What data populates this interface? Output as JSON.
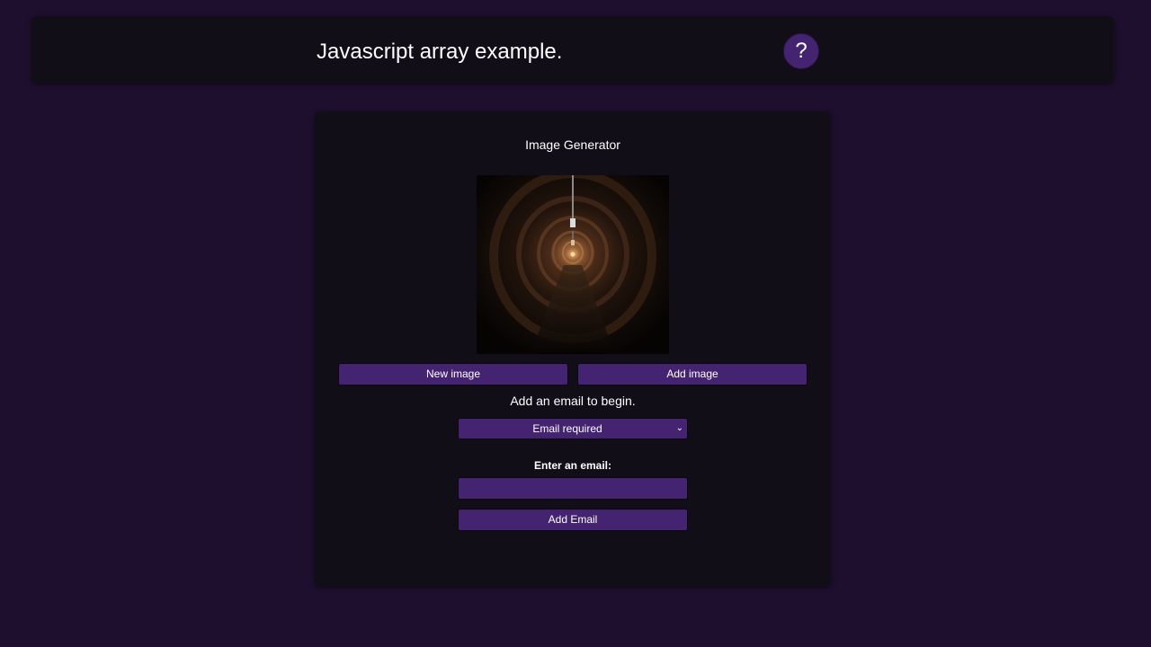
{
  "header": {
    "title": "Javascript array example.",
    "help_label": "?"
  },
  "card": {
    "title": "Image Generator",
    "image_alt": "dark brick tunnel with hanging lights",
    "new_image_label": "New image",
    "add_image_label": "Add image",
    "status_text": "Add an email to begin.",
    "email_select": {
      "selected": "Email required",
      "arrow_icon": "chevron-down-icon"
    },
    "email_field_label": "Enter an email:",
    "email_input_value": "",
    "email_input_placeholder": "",
    "add_email_label": "Add Email"
  },
  "colors": {
    "background": "#1e0f2e",
    "panel": "#110e18",
    "accent": "#442470"
  }
}
